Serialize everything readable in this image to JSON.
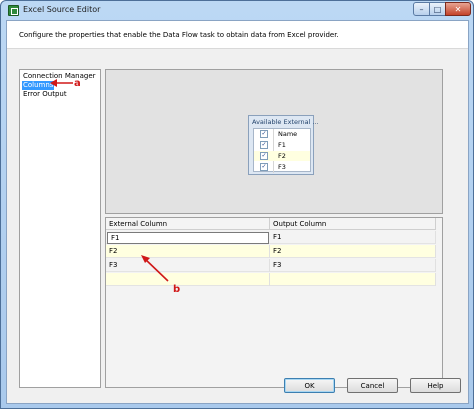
{
  "window": {
    "title": "Excel Source Editor",
    "min_glyph": "–",
    "max_glyph": "□",
    "close_glyph": "✕"
  },
  "description": "Configure the properties that enable the Data Flow task to obtain data from Excel provider.",
  "nav": {
    "items": [
      {
        "label": "Connection Manager",
        "selected": false
      },
      {
        "label": "Columns",
        "selected": true
      },
      {
        "label": "Error Output",
        "selected": false
      }
    ]
  },
  "available_columns": {
    "title": "Available External ...",
    "header": "Name",
    "rows": [
      {
        "name": "F1",
        "checked": true
      },
      {
        "name": "F2",
        "checked": true
      },
      {
        "name": "F3",
        "checked": true
      }
    ],
    "check_glyph": "✓"
  },
  "grid": {
    "headers": [
      "External Column",
      "Output Column"
    ],
    "rows": [
      {
        "external": "F1",
        "output": "F1"
      },
      {
        "external": "F2",
        "output": "F2"
      },
      {
        "external": "F3",
        "output": "F3"
      }
    ]
  },
  "buttons": {
    "ok": "OK",
    "cancel": "Cancel",
    "help": "Help"
  },
  "annotations": {
    "a": "a",
    "b": "b",
    "color": "#d01818"
  }
}
